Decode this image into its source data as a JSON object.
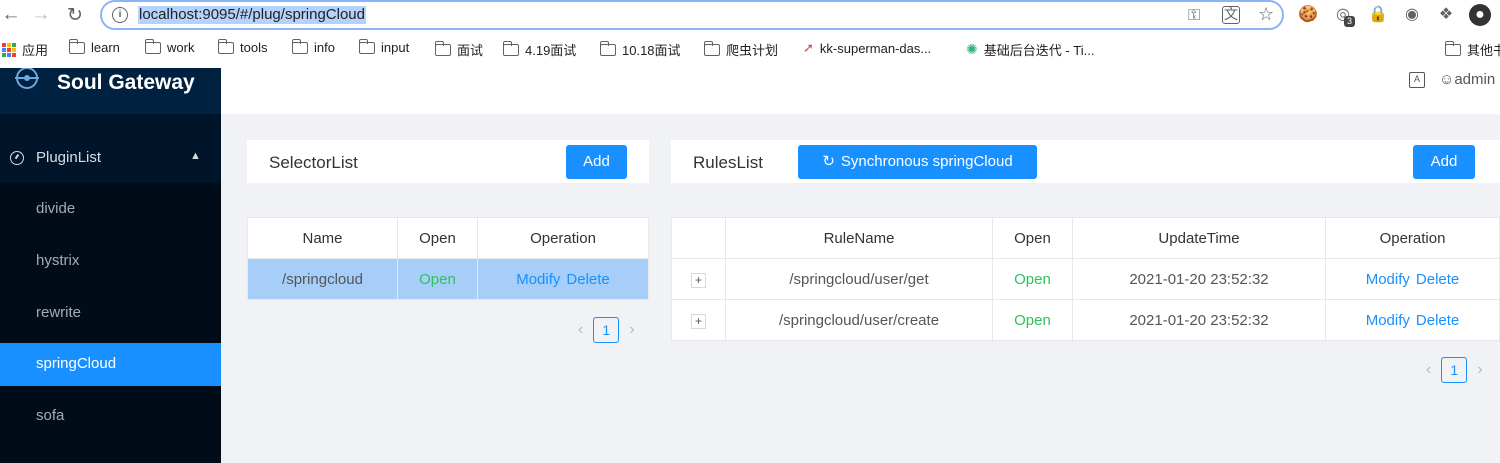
{
  "browser": {
    "url": "localhost:9095/#/plug/springCloud",
    "extension_badge": "3",
    "bookmarks": [
      {
        "label": "应用",
        "icon": "apps-grid-icon"
      },
      {
        "label": "learn",
        "icon": "folder-icon"
      },
      {
        "label": "work",
        "icon": "folder-icon"
      },
      {
        "label": "tools",
        "icon": "folder-icon"
      },
      {
        "label": "info",
        "icon": "folder-icon"
      },
      {
        "label": "input",
        "icon": "folder-icon"
      },
      {
        "label": "面试",
        "icon": "folder-icon"
      },
      {
        "label": "4.19面试",
        "icon": "folder-icon"
      },
      {
        "label": "10.18面试",
        "icon": "folder-icon"
      },
      {
        "label": "爬虫计划",
        "icon": "folder-icon"
      },
      {
        "label": "kk-superman-das...",
        "icon": "rocket-icon"
      },
      {
        "label": "基础后台迭代 - Ti...",
        "icon": "star-flower-icon"
      },
      {
        "label": "其他书",
        "icon": "folder-icon"
      }
    ]
  },
  "app": {
    "title": "Soul Gateway",
    "user": "admin",
    "sidebar": {
      "group_label": "PluginList",
      "items": [
        "divide",
        "hystrix",
        "rewrite",
        "springCloud",
        "sofa"
      ],
      "selected": "springCloud"
    },
    "selector": {
      "title": "SelectorList",
      "add_label": "Add",
      "columns": [
        "Name",
        "Open",
        "Operation"
      ],
      "rows": [
        {
          "name": "/springcloud",
          "open": "Open",
          "modify": "Modify",
          "delete": "Delete"
        }
      ],
      "page": "1"
    },
    "rules": {
      "title": "RulesList",
      "sync_label": "Synchronous springCloud",
      "add_label": "Add",
      "columns": [
        "",
        "RuleName",
        "Open",
        "UpdateTime",
        "Operation"
      ],
      "rows": [
        {
          "expand": "+",
          "name": "/springcloud/user/get",
          "open": "Open",
          "time": "2021-01-20 23:52:32",
          "modify": "Modify",
          "delete": "Delete"
        },
        {
          "expand": "+",
          "name": "/springcloud/user/create",
          "open": "Open",
          "time": "2021-01-20 23:52:32",
          "modify": "Modify",
          "delete": "Delete"
        }
      ],
      "page": "1"
    }
  },
  "colors": {
    "primary": "#1890ff",
    "sider": "#001529",
    "open": "#2fc25b",
    "selected_row": "#a6cef8"
  }
}
